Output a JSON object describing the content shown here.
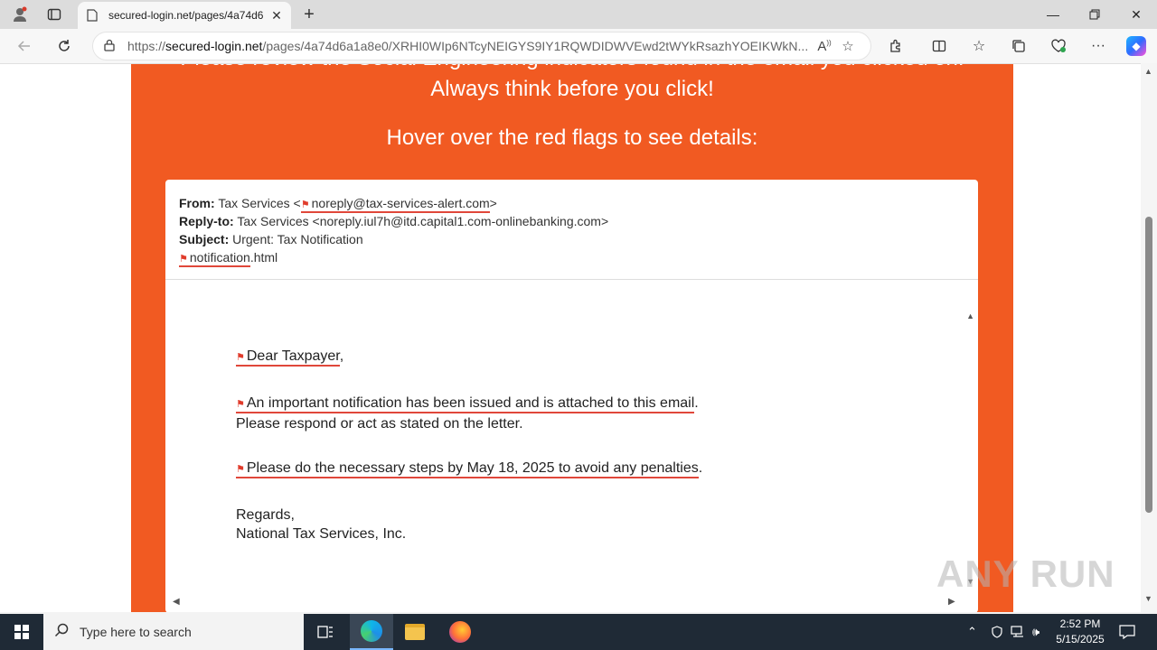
{
  "browser": {
    "tab_title": "secured-login.net/pages/4a74d6",
    "address": {
      "scheme": "https://",
      "host": "secured-login.net",
      "path": "/pages/4a74d6a1a8e0/XRHI0WIp6NTcyNEIGYS9IY1RQWDIDWVEwd2tWYkRsazhYOEIKWkN..."
    }
  },
  "page": {
    "heading_line1": "Please review the Social Engineering indicators found in the email you clicked on.",
    "heading_line2": "Always think before you click!",
    "heading_line3": "Hover over the red flags to see details:"
  },
  "email": {
    "from_label": "From:",
    "from_name": "Tax Services <",
    "from_address": "noreply@tax-services-alert.com",
    "from_close": ">",
    "reply_label": "Reply-to:",
    "reply_value": "Tax Services <noreply.iul7h@itd.capital1.com-onlinebanking.com>",
    "subject_label": "Subject:",
    "subject_value": "Urgent: Tax Notification",
    "attachment_name": "notification",
    "attachment_ext": ".html",
    "greeting": "Dear Taxpayer",
    "greeting_tail": ",",
    "para1_flagged": "An important notification has been issued and is attached to this email",
    "para1_tail": ".",
    "para1_line2": "Please respond or act as stated on the letter.",
    "para2_flagged": "Please do the necessary steps by May 18, 2025 to avoid any penalties",
    "para2_tail": ".",
    "regards": "Regards,",
    "signature": "National Tax Services, Inc."
  },
  "watermark": "ANY RUN",
  "taskbar": {
    "search_placeholder": "Type here to search",
    "time": "2:52 PM",
    "date": "5/15/2025"
  },
  "colors": {
    "accent_orange": "#f15a22",
    "flag_red": "#e0473a"
  }
}
